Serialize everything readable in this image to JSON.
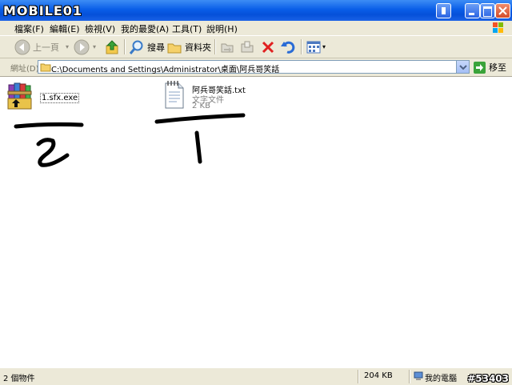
{
  "logo": {
    "text": "MOBILE01"
  },
  "menu": {
    "items": [
      "檔案(F)",
      "編輯(E)",
      "檢視(V)",
      "我的最愛(A)",
      "工具(T)",
      "說明(H)"
    ]
  },
  "toolbar": {
    "back_label": "上一頁",
    "search_label": "搜尋",
    "folders_label": "資料夾"
  },
  "address": {
    "label": "網址(D)",
    "path": "C:\\Documents and Settings\\Administrator\\桌面\\阿兵哥笑話",
    "go_label": "移至"
  },
  "files": [
    {
      "name": "1.sfx.exe",
      "icon": "winrar-sfx-icon"
    },
    {
      "name": "阿兵哥笑話.txt",
      "type": "文字文件",
      "size": "2 KB",
      "icon": "text-document-icon"
    }
  ],
  "status": {
    "count": "2 個物件",
    "size": "204 KB",
    "location": "我的電腦"
  },
  "watermark": "#53403",
  "colors": {
    "titlebar": "#0a5ee8",
    "chrome": "#ece9d8"
  }
}
